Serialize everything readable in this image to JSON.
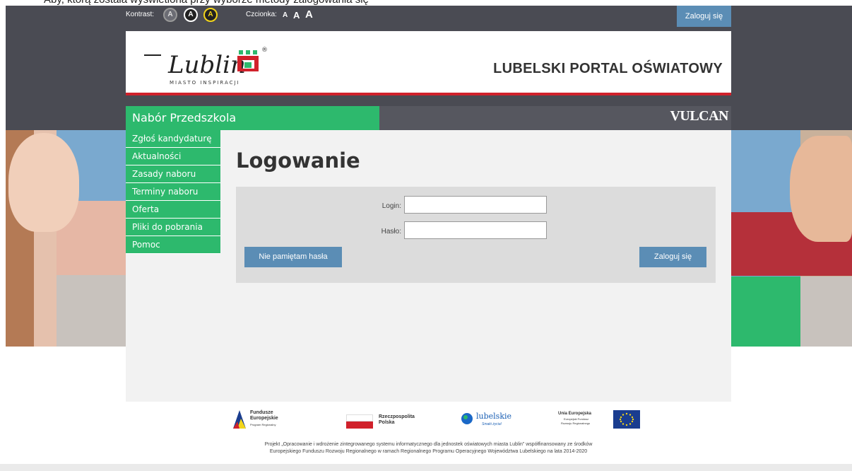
{
  "cut_off_top_text": "Aby, którą została wyświetlona przy wyborze metody zalogowania się",
  "topbar": {
    "kontrast_label": "Kontrast:",
    "kontrast_buttons": [
      "A",
      "A",
      "A"
    ],
    "czcionka_label": "Czcionka:",
    "font_buttons": [
      "A",
      "A",
      "A"
    ],
    "login_button": "Zaloguj się"
  },
  "header": {
    "logo_text": "Lublin",
    "logo_tagline": "MIASTO INSPIRACJI",
    "logo_registered": "®",
    "portal_title": "LUBELSKI PORTAL OŚWIATOWY"
  },
  "nav": {
    "section_title": "Nabór Przedszkola",
    "brand": "VULCAN"
  },
  "menu": {
    "items": [
      "Zgłoś kandydaturę",
      "Aktualności",
      "Zasady naboru",
      "Terminy naboru",
      "Oferta",
      "Pliki do pobrania",
      "Pomoc"
    ]
  },
  "main": {
    "heading": "Logowanie",
    "login_label": "Login:",
    "login_value": "",
    "password_label": "Hasło:",
    "password_value": "",
    "forgot_button": "Nie pamiętam hasła",
    "submit_button": "Zaloguj się"
  },
  "footer": {
    "logos": {
      "fe_line1": "Fundusze",
      "fe_line2": "Europejskie",
      "fe_line3": "Program Regionalny",
      "rp_line1": "Rzeczpospolita",
      "rp_line2": "Polska",
      "lub_line1": "lubelskie",
      "lub_line2": "Smaki życia!",
      "ue_line1": "Unia Europejska",
      "ue_line2": "Europejski Fundusz",
      "ue_line3": "Rozwoju Regionalnego"
    },
    "text_line1": "Projekt „Opracowanie i wdrożenie zintegrowanego systemu informatycznego dla jednostek oświatowych miasta Lublin” współfinansowany ze środków",
    "text_line2": "Europejskiego Funduszu Rozwoju Regionalnego w ramach Regionalnego Programu Operacyjnego Województwa Lubelskiego na lata 2014-2020"
  },
  "colors": {
    "green": "#2db96d",
    "blue_button": "#5b8db5",
    "dark_band": "#4a4b53",
    "red_line": "#d0212b"
  }
}
